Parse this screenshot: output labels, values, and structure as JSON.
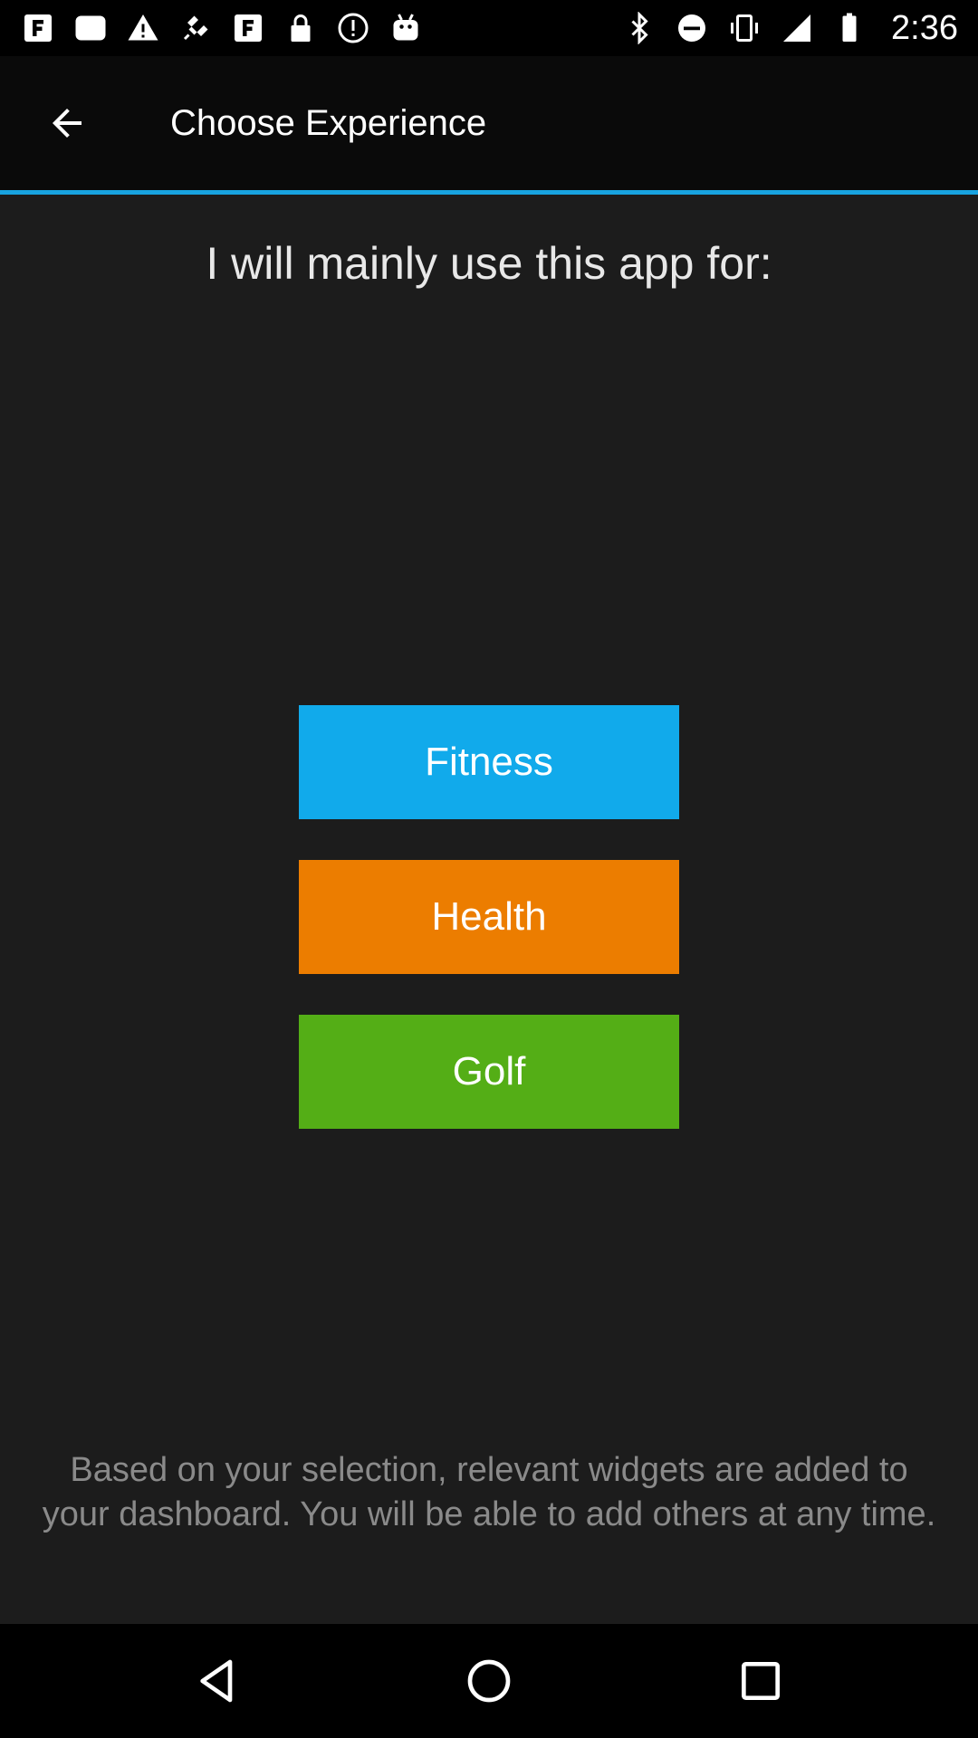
{
  "status_bar": {
    "time": "2:36",
    "left_icons": [
      "notification-f-icon",
      "image-icon",
      "notification-f-icon",
      "alert-icon",
      "fake-gps-icon",
      "notification-f-icon",
      "lock-icon",
      "info-icon",
      "android-icon"
    ],
    "right_icons": [
      "bluetooth-icon",
      "do-not-disturb-icon",
      "vibrate-icon",
      "signal-icon",
      "battery-icon"
    ]
  },
  "app_bar": {
    "title": "Choose Experience",
    "accent_color": "#18a3e0"
  },
  "main": {
    "prompt": "I will mainly use this app for:",
    "options": [
      {
        "label": "Fitness",
        "color": "#11aaeb"
      },
      {
        "label": "Health",
        "color": "#ec7d00"
      },
      {
        "label": "Golf",
        "color": "#54ae16"
      }
    ],
    "footer": "Based on your selection, relevant widgets are added to your dashboard. You will be able to add others at any time."
  },
  "nav_bar": {
    "buttons": [
      "back-triangle-icon",
      "home-circle-icon",
      "recents-square-icon"
    ]
  }
}
